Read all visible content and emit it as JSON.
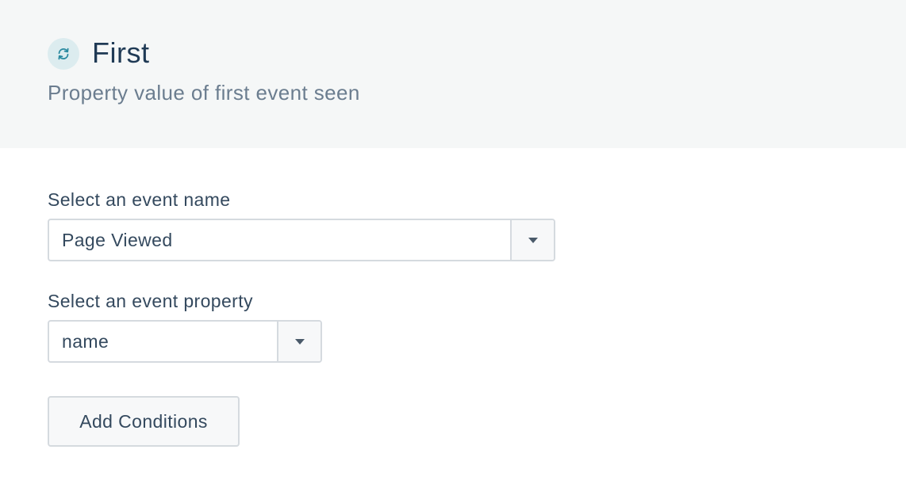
{
  "header": {
    "icon": "refresh-icon",
    "title": "First",
    "subtitle": "Property value of first event seen",
    "colors": {
      "background": "#f5f7f7",
      "icon_bg": "#dcecef",
      "icon_fg": "#2a8aa0"
    }
  },
  "form": {
    "event_name": {
      "label": "Select an event name",
      "value": "Page Viewed",
      "icon": "chevron-down-icon"
    },
    "event_property": {
      "label": "Select an event property",
      "value": "name",
      "icon": "chevron-down-icon"
    },
    "add_conditions_label": "Add Conditions"
  }
}
